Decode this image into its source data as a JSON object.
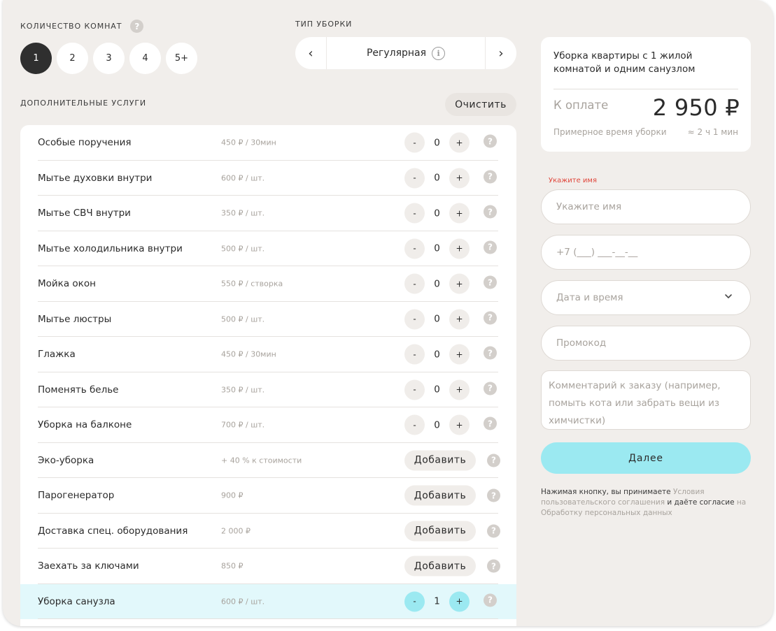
{
  "rooms": {
    "label": "КОЛИЧЕСТВО КОМНАТ",
    "help": "?",
    "options": [
      "1",
      "2",
      "3",
      "4",
      "5+"
    ],
    "selected": "1"
  },
  "cleaning_type": {
    "label": "ТИП УБОРКИ",
    "value": "Регулярная",
    "prev": "‹",
    "next": "›",
    "info": "i"
  },
  "extras": {
    "label": "ДОПОЛНИТЕЛЬНЫЕ УСЛУГИ",
    "clear_label": "Очистить",
    "add_label": "Добавить",
    "minus": "-",
    "plus": "+",
    "help": "?",
    "items": [
      {
        "name": "Особые поручения",
        "price": "450 ₽ / 30мин",
        "kind": "stepper",
        "qty": "0"
      },
      {
        "name": "Мытье духовки внутри",
        "price": "600 ₽ / шт.",
        "kind": "stepper",
        "qty": "0"
      },
      {
        "name": "Мытье СВЧ внутри",
        "price": "350 ₽ / шт.",
        "kind": "stepper",
        "qty": "0"
      },
      {
        "name": "Мытье холодильника внутри",
        "price": "500 ₽ / шт.",
        "kind": "stepper",
        "qty": "0"
      },
      {
        "name": "Мойка окон",
        "price": "550 ₽ / створка",
        "kind": "stepper",
        "qty": "0"
      },
      {
        "name": "Мытье люстры",
        "price": "500 ₽ / шт.",
        "kind": "stepper",
        "qty": "0"
      },
      {
        "name": "Глажка",
        "price": "450 ₽ / 30мин",
        "kind": "stepper",
        "qty": "0"
      },
      {
        "name": "Поменять белье",
        "price": "350 ₽ / шт.",
        "kind": "stepper",
        "qty": "0"
      },
      {
        "name": "Уборка на балконе",
        "price": "700 ₽ / шт.",
        "kind": "stepper",
        "qty": "0"
      },
      {
        "name": "Эко-уборка",
        "price": "+ 40 % к стоимости",
        "kind": "add"
      },
      {
        "name": "Парогенератор",
        "price": "900 ₽",
        "kind": "add"
      },
      {
        "name": "Доставка спец. оборудования",
        "price": "2 000 ₽",
        "kind": "add"
      },
      {
        "name": "Заехать за ключами",
        "price": "850 ₽",
        "kind": "add"
      },
      {
        "name": "Уборка санузла",
        "price": "600 ₽ / шт.",
        "kind": "stepper",
        "qty": "1",
        "highlight": true
      }
    ]
  },
  "summary": {
    "title": "Уборка квартиры с 1 жилой комнатой и одним санузлом",
    "pay_label": "К оплате",
    "pay_value": "2 950 ₽",
    "time_label": "Примерное время уборки",
    "time_value": "≈ 2 ч 1 мин"
  },
  "form": {
    "name_error": "Укажите имя",
    "name_placeholder": "Укажите имя",
    "phone_placeholder": "+7 (___) ___-__-__",
    "datetime_placeholder": "Дата и время",
    "promo_placeholder": "Промокод",
    "comment_placeholder": "Комментарий к заказу (например, помыть кота или забрать вещи из химчистки)",
    "submit_label": "Далее"
  },
  "legal": {
    "prefix": "Нажимая кнопку, вы принимаете ",
    "link1": "Условия пользовательского соглашения",
    "middle": " и даёте согласие ",
    "link2": "на Обработку персональных данных"
  },
  "colors": {
    "background": "#f1eeeb",
    "accent": "#9be9f1",
    "highlight_row": "#e2f8fb",
    "error": "#e0463b",
    "muted": "#a8a39d"
  }
}
